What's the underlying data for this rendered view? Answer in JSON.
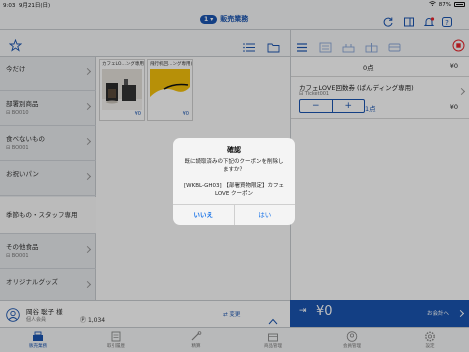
{
  "status_bar": {
    "time": "9:03",
    "date": "9月21日(日)",
    "battery": "87%"
  },
  "header": {
    "badge": "1",
    "title": "販売業務"
  },
  "sidebar": {
    "items": [
      {
        "label": "今だけ",
        "code": ""
      },
      {
        "label": "部署別商品",
        "code": "BO010"
      },
      {
        "label": "食べないもの",
        "code": "BO001"
      },
      {
        "label": "お祝いパン",
        "code": ""
      },
      {
        "label": "季節もの・スタッフ専用",
        "code": ""
      },
      {
        "label": "その他食品",
        "code": "BO001"
      },
      {
        "label": "オリジナルグッズ",
        "code": ""
      }
    ]
  },
  "products": [
    {
      "name": "カフェLO…ング専用)",
      "price": "¥0"
    },
    {
      "name": "飛行机回…ング専用)",
      "price": "¥0"
    }
  ],
  "cart": {
    "count": "0点",
    "total": "¥0",
    "item_name": "カフェLOVE回数券 (ぱんディング専用)",
    "item_code": "Ticket001",
    "item_qty": "1点",
    "item_price": "¥0",
    "minus": "−",
    "plus": "+"
  },
  "customer": {
    "name": "岡谷 聡子 様",
    "type": "個人会員",
    "points": "1,034",
    "change_label": "変更"
  },
  "checkout": {
    "total": "¥0",
    "label": "お会計へ"
  },
  "tabs": [
    {
      "label": "販売業務",
      "icon": "register-icon"
    },
    {
      "label": "取引履歴",
      "icon": "receipt-icon"
    },
    {
      "label": "精算",
      "icon": "tools-icon"
    },
    {
      "label": "商品管理",
      "icon": "box-icon"
    },
    {
      "label": "会員管理",
      "icon": "user-icon"
    },
    {
      "label": "設定",
      "icon": "gear-icon"
    }
  ],
  "dialog": {
    "title": "確認",
    "message": "既に読取済みの下記のクーポンを削除しますか？",
    "coupon": "[WKBL-GH03] 【部署買物限定】カフェLOVE クーポン",
    "no_label": "いいえ",
    "yes_label": "はい"
  },
  "colors": {
    "accent": "#1a55b0",
    "alert": "#e8252b",
    "dialog_link": "#1a74e8"
  }
}
